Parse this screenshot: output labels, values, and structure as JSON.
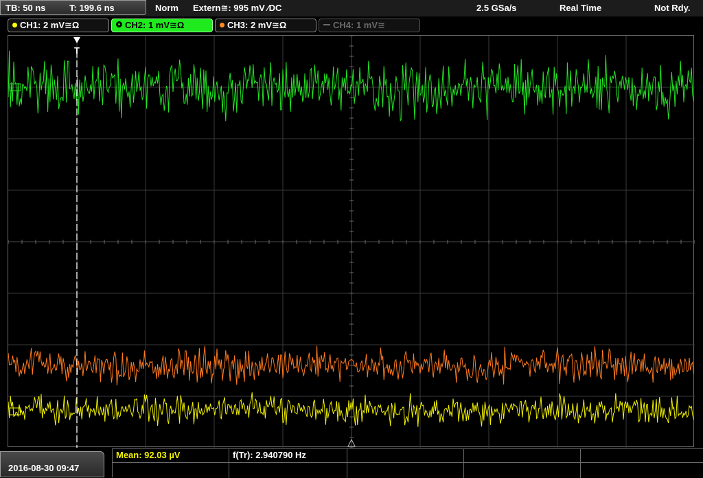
{
  "topbar": {
    "timebase": "TB: 50 ns",
    "trigger_time": "T: 199.6 ns",
    "mode": "Norm",
    "trigger_source": "Extern≅: 995 mV ⁄DC",
    "sample_rate": "2.5 GSa/s",
    "acquisition": "Real Time",
    "status": "Not Rdy."
  },
  "channels": [
    {
      "label": "CH1: 2 mV≅Ω",
      "color": "#ffff00",
      "state": "on"
    },
    {
      "label": "CH2: 1 mV≅Ω",
      "color": "#00ff00",
      "state": "active"
    },
    {
      "label": "CH3: 2 mV≅Ω",
      "color": "#ff8a1e",
      "state": "on"
    },
    {
      "label": "CH4: 1 mV≅",
      "color": "#6a6a6a",
      "state": "off"
    }
  ],
  "traces": {
    "ch2_color": "#22e622",
    "ch3_color": "#ff7a1e",
    "ch1_color": "#f2f200"
  },
  "trigger_marker": "T",
  "measurements": {
    "mean": "Mean: 92.03 µV",
    "frequency": "f(Tr): 2.940790 Hz"
  },
  "datetime": "2016-08-30 09:47"
}
